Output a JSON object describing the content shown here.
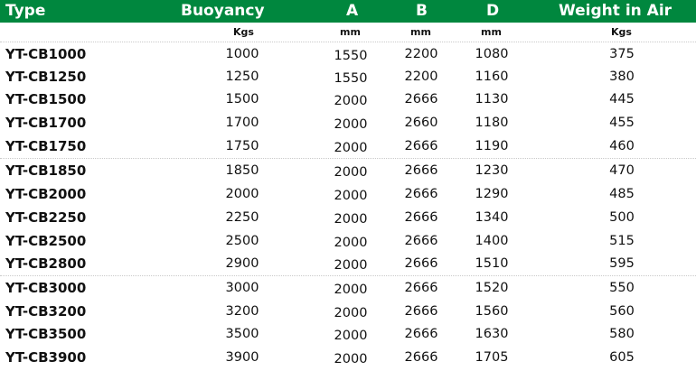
{
  "header": {
    "type": "Type",
    "buoyancy": "Buoyancy",
    "a": "A",
    "b": "B",
    "d": "D",
    "weight": "Weight in Air"
  },
  "units": {
    "buoyancy": "Kgs",
    "a": "mm",
    "b": "mm",
    "d": "mm",
    "weight": "Kgs"
  },
  "rows": [
    {
      "type": "YT-CB1000",
      "buoyancy": "1000",
      "a": "1550",
      "b": "2200",
      "d": "1080",
      "weight": "375"
    },
    {
      "type": "YT-CB1250",
      "buoyancy": "1250",
      "a": "1550",
      "b": "2200",
      "d": "1160",
      "weight": "380"
    },
    {
      "type": "YT-CB1500",
      "buoyancy": "1500",
      "a": "2000",
      "b": "2666",
      "d": "1130",
      "weight": "445"
    },
    {
      "type": "YT-CB1700",
      "buoyancy": "1700",
      "a": "2000",
      "b": "2660",
      "d": "1180",
      "weight": "455"
    },
    {
      "type": "YT-CB1750",
      "buoyancy": "1750",
      "a": "2000",
      "b": "2666",
      "d": "1190",
      "weight": "460"
    },
    {
      "type": "YT-CB1850",
      "buoyancy": "1850",
      "a": "2000",
      "b": "2666",
      "d": "1230",
      "weight": "470"
    },
    {
      "type": "YT-CB2000",
      "buoyancy": "2000",
      "a": "2000",
      "b": "2666",
      "d": "1290",
      "weight": "485"
    },
    {
      "type": "YT-CB2250",
      "buoyancy": "2250",
      "a": "2000",
      "b": "2666",
      "d": "1340",
      "weight": "500"
    },
    {
      "type": "YT-CB2500",
      "buoyancy": "2500",
      "a": "2000",
      "b": "2666",
      "d": "1400",
      "weight": "515"
    },
    {
      "type": "YT-CB2800",
      "buoyancy": "2900",
      "a": "2000",
      "b": "2666",
      "d": "1510",
      "weight": "595"
    },
    {
      "type": "YT-CB3000",
      "buoyancy": "3000",
      "a": "2000",
      "b": "2666",
      "d": "1520",
      "weight": "550"
    },
    {
      "type": "YT-CB3200",
      "buoyancy": "3200",
      "a": "2000",
      "b": "2666",
      "d": "1560",
      "weight": "560"
    },
    {
      "type": "YT-CB3500",
      "buoyancy": "3500",
      "a": "2000",
      "b": "2666",
      "d": "1630",
      "weight": "580"
    },
    {
      "type": "YT-CB3900",
      "buoyancy": "3900",
      "a": "2000",
      "b": "2666",
      "d": "1705",
      "weight": "605"
    }
  ],
  "colors": {
    "header_background": "#00873e",
    "header_text": "#ffffff",
    "body_text": "#111111",
    "divider": "#c9c9c9"
  }
}
